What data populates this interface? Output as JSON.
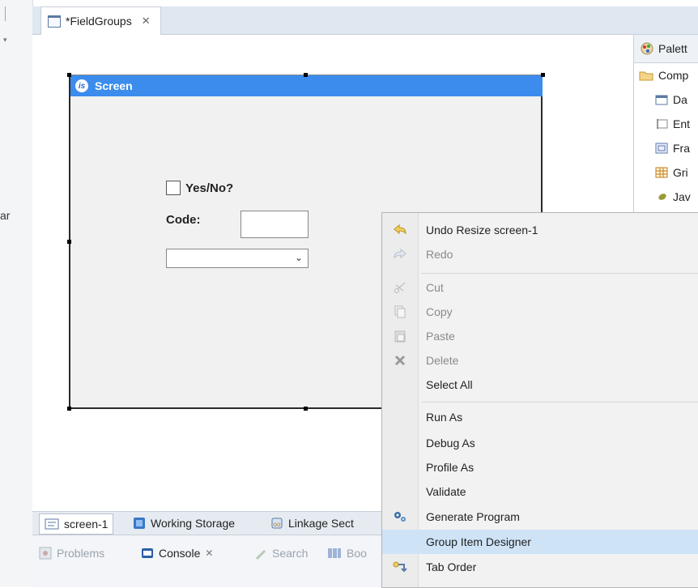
{
  "left_strip": {
    "text": "ar"
  },
  "editor": {
    "tab_title": "*FieldGroups",
    "tab_close": "✕"
  },
  "screen": {
    "title": "Screen",
    "checkbox_label": "Yes/No?",
    "code_label": "Code:",
    "combo_arrow": "⌄"
  },
  "palette": {
    "title": "Palett",
    "items": [
      {
        "label": "Comp",
        "icon": "folder-icon"
      },
      {
        "label": "Da",
        "icon": "date-icon"
      },
      {
        "label": "Ent",
        "icon": "entry-field-icon"
      },
      {
        "label": "Fra",
        "icon": "frame-icon"
      },
      {
        "label": "Gri",
        "icon": "grid-icon"
      },
      {
        "label": "Jav",
        "icon": "java-bean-icon"
      }
    ]
  },
  "bottom_tabs": [
    {
      "label": "screen-1",
      "icon": "screen-icon"
    },
    {
      "label": "Working Storage",
      "icon": "storage-icon"
    },
    {
      "label": "Linkage Sect",
      "icon": "linkage-icon"
    }
  ],
  "views": [
    {
      "label": "Problems",
      "active": false
    },
    {
      "label": "Console",
      "active": true,
      "close": "✕"
    },
    {
      "label": "Search",
      "active": false
    },
    {
      "label": "Boo",
      "active": false
    }
  ],
  "context_menu": [
    {
      "label": "Undo Resize screen-1",
      "icon": "undo-icon",
      "enabled": true
    },
    {
      "label": "Redo",
      "icon": "redo-icon",
      "enabled": false
    },
    {
      "label": "Cut",
      "icon": "cut-icon",
      "enabled": false
    },
    {
      "label": "Copy",
      "icon": "copy-icon",
      "enabled": false
    },
    {
      "label": "Paste",
      "icon": "paste-icon",
      "enabled": false
    },
    {
      "label": "Delete",
      "icon": "delete-icon",
      "enabled": false
    },
    {
      "label": "Select All",
      "icon": "",
      "enabled": true
    },
    {
      "label": "Run As",
      "icon": "",
      "enabled": true
    },
    {
      "label": "Debug As",
      "icon": "",
      "enabled": true
    },
    {
      "label": "Profile As",
      "icon": "",
      "enabled": true
    },
    {
      "label": "Validate",
      "icon": "",
      "enabled": true
    },
    {
      "label": "Generate Program",
      "icon": "gears-icon",
      "enabled": true
    },
    {
      "label": "Group Item Designer",
      "icon": "",
      "enabled": true,
      "highlighted": true
    },
    {
      "label": "Tab Order",
      "icon": "tab-order-icon",
      "enabled": true
    }
  ],
  "colors": {
    "selection_blue": "#3b8ced",
    "menu_highlight": "#cfe3f7",
    "tab_bar": "#dfe7f1"
  }
}
